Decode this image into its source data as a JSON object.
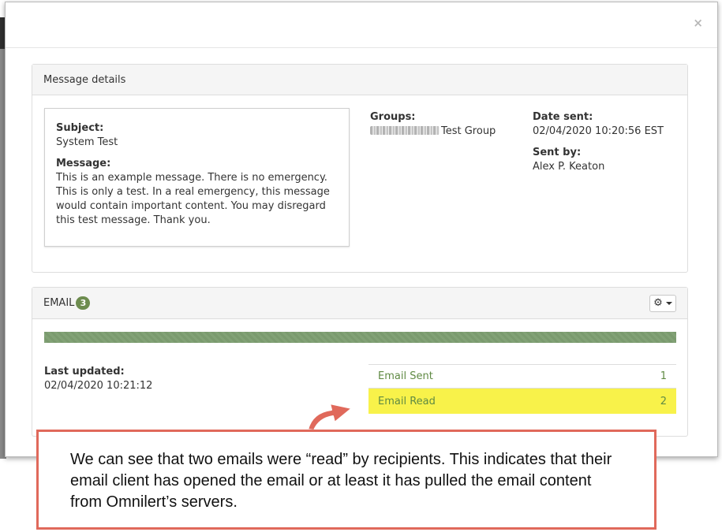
{
  "modal": {
    "close_label": "×"
  },
  "message_details": {
    "heading": "Message details",
    "subject_label": "Subject:",
    "subject": "System Test",
    "message_label": "Message:",
    "message": "This is an example message. There is no emergency. This is only a test. In a real emergency, this message would contain important content. You may disregard this test message. Thank you.",
    "groups_label": "Groups:",
    "group_name": "Test Group",
    "date_sent_label": "Date sent:",
    "date_sent": "02/04/2020 10:20:56 EST",
    "sent_by_label": "Sent by:",
    "sent_by": "Alex P. Keaton"
  },
  "email": {
    "heading": "EMAIL",
    "count": "3",
    "progress_fraction": 1.0,
    "last_updated_label": "Last updated:",
    "last_updated": "02/04/2020 10:21:12",
    "stats": [
      {
        "label": "Email Sent",
        "value": "1"
      },
      {
        "label": "Email Read",
        "value": "2"
      }
    ]
  },
  "callout": {
    "text": "We can see that two emails were “read” by recipients. This indicates that their email client has opened the email or at least it has pulled the email content from Omnilert’s servers."
  },
  "colors": {
    "accent_green": "#6d8c4f",
    "link_green": "#5f8a43",
    "highlight": "#f8f24a",
    "callout_border": "#e0695b"
  },
  "icons": [
    "close-icon",
    "gear-icon",
    "chevron-down-icon",
    "arrow-icon"
  ]
}
